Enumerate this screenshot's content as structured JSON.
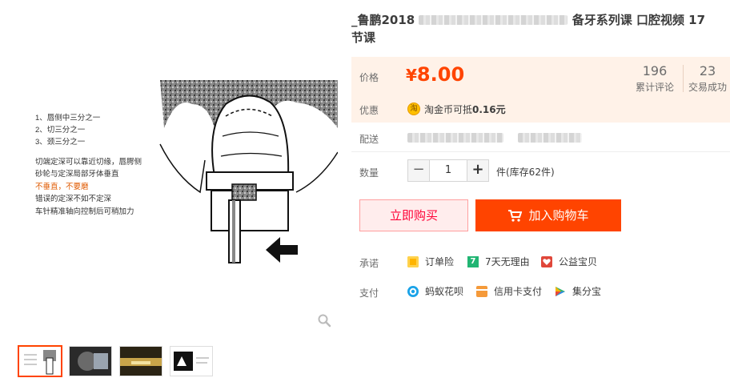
{
  "product": {
    "title_line1": "_鲁鹏2018",
    "title_blurred_note": "",
    "title_line1_tail": "备牙系列课 口腔视频 17",
    "title_line2": "节课"
  },
  "image_annotations": {
    "items": [
      "1、唇侧中三分之一",
      "2、切三分之一",
      "3、颈三分之一"
    ],
    "note1": "切端定深可以靠近切缘，唇腭侧",
    "note2": "砂轮与定深局部牙体垂直",
    "warn": "不垂直，不要磨",
    "note3": "错误的定深不如不定深",
    "note4": "车针精准轴向控制后可稍加力"
  },
  "price": {
    "label": "价格",
    "currency": "¥",
    "value": "8.00"
  },
  "stats": [
    {
      "count": "196",
      "label": "累计评论"
    },
    {
      "count": "23",
      "label": "交易成功"
    }
  ],
  "promo": {
    "label": "优惠",
    "coin_glyph": "淘",
    "text_prefix": "淘金币可抵",
    "amount": "0.16元"
  },
  "delivery": {
    "label": "配送"
  },
  "quantity": {
    "label": "数量",
    "minus": "−",
    "value": "1",
    "plus": "+",
    "stock_text": "件(库存62件)"
  },
  "actions": {
    "buy_now": "立即购买",
    "add_to_cart": "加入购物车"
  },
  "promise": {
    "label": "承诺",
    "items": [
      "订单险",
      "7天无理由",
      "公益宝贝"
    ]
  },
  "payment": {
    "label": "支付",
    "items": [
      "蚂蚁花呗",
      "信用卡支付",
      "集分宝"
    ]
  },
  "colors": {
    "accent": "#ff4400",
    "price_bg": "#fff2e8",
    "warn_text": "#e05a00"
  }
}
